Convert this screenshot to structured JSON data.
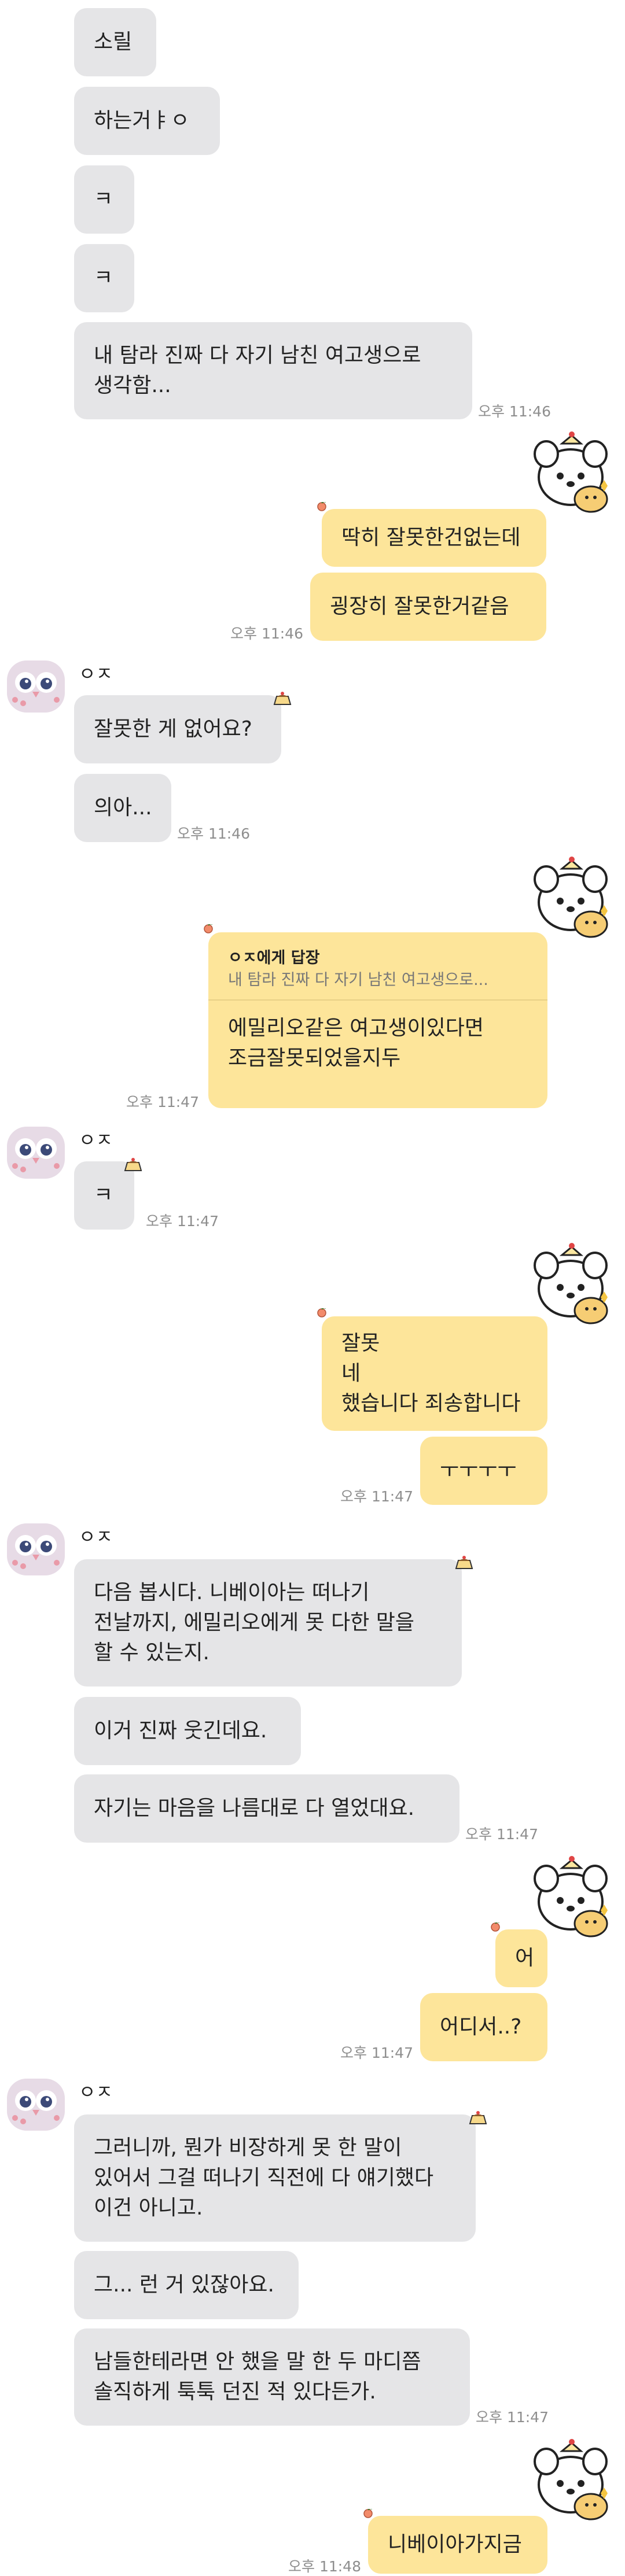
{
  "contact": {
    "name": "ㅇㅈ"
  },
  "msgs": {
    "m1": "소릴",
    "m2": "하는거ㅑㅇ",
    "m3": "ㅋ",
    "m4": "ㅋ",
    "m5a": "내 탐라 진짜 다 자기 남친 여고생으로",
    "m5b": "생각함...",
    "m6": "딱히 잘못한건없는데",
    "m7": "굉장히 잘못한거같음",
    "m8": "잘못한 게 없어요?",
    "m9": "의아...",
    "m10_label": "ㅇㅈ에게 답장",
    "m10_quote": "내 탐라 진짜 다 자기 남친 여고생으로...",
    "m10a": "에밀리오같은 여고생이있다면",
    "m10b": "조금잘못되었을지두",
    "m11": "ㅋ",
    "m12a": "잘못",
    "m12b": "네",
    "m12c": "했습니다 죄송합니다",
    "m13": "ㅜㅜㅜㅜ",
    "m14a": "다음 봅시다. 니베이아는 떠나기",
    "m14b": "전날까지, 에밀리오에게 못 다한 말을",
    "m14c": "할 수 있는지.",
    "m15": "이거 진짜 웃긴데요.",
    "m16": "자기는 마음을 나름대로 다 열었대요.",
    "m17": "어",
    "m18": "어디서..?",
    "m19a": "그러니까, 뭔가 비장하게 못 한 말이",
    "m19b": "있어서 그걸 떠나기 직전에 다 얘기했다",
    "m19c": "이건 아니고.",
    "m20": "그... 런 거 있잖아요.",
    "m21a": "남들한테라면 안 했을 말 한 두 마디쯤",
    "m21b": "솔직하게 툭툭 던진 적 있다든가.",
    "m22": "니베이아가지금"
  },
  "times": {
    "t1": "오후 11:46",
    "t2": "오후 11:46",
    "t3": "오후 11:46",
    "t4": "오후 11:47",
    "t5": "오후 11:47",
    "t6": "오후 11:47",
    "t7": "오후 11:47",
    "t8": "오후 11:47",
    "t9": "오후 11:47",
    "t10": "오후 11:48"
  },
  "colors": {
    "incoming": "#e5e5e7",
    "outgoing": "#fde59a",
    "timestamp": "#8e8e8e"
  },
  "icons": {
    "avatar": "pink-owl-avatar-icon",
    "sticker": "hamster-sticker-icon",
    "reaction": "pudding-reaction-icon",
    "heart": "heart-icon"
  }
}
